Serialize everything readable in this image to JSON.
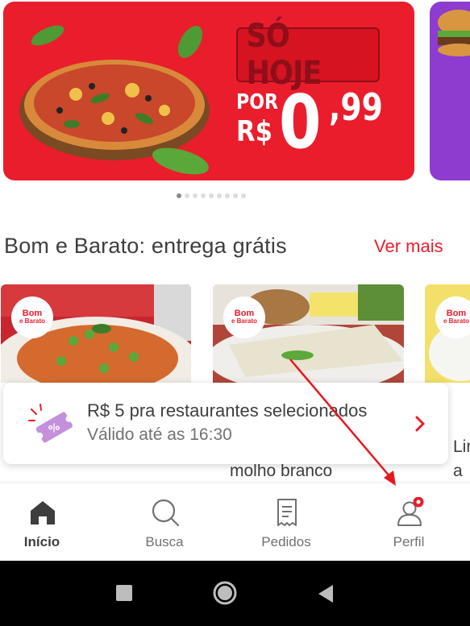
{
  "banner": {
    "title": "SÓ HOJE",
    "price_prefix_1": "POR",
    "price_prefix_2": "R$",
    "price_int": "0",
    "price_cents": ",99",
    "accent_color": "#ea1d2c",
    "next_banner_color": "#8e3bd0",
    "dots_total": 9,
    "dots_active": 1
  },
  "section": {
    "title": "Bom e Barato: entrega grátis",
    "see_more": "Ver mais"
  },
  "cards": [
    {
      "badge_line1": "Bom",
      "badge_line2": "e Barato"
    },
    {
      "badge_line1": "Bom",
      "badge_line2": "e Barato",
      "name": "molho branco"
    },
    {
      "badge_line1": "Bom",
      "badge_line2": "e Barato",
      "name_line1": "Lin",
      "name_line2": "a b"
    }
  ],
  "coupon": {
    "title": "R$ 5 pra restaurantes selecionados",
    "subtitle": "Válido até as 16:30",
    "icon": "coupon-ticket-icon"
  },
  "nav": {
    "items": [
      {
        "label": "Início",
        "icon": "home-icon",
        "active": true
      },
      {
        "label": "Busca",
        "icon": "search-icon",
        "active": false
      },
      {
        "label": "Pedidos",
        "icon": "receipt-icon",
        "active": false
      },
      {
        "label": "Perfil",
        "icon": "profile-icon",
        "active": false,
        "notification": true
      }
    ]
  },
  "system": {
    "icons": [
      "recents-square-icon",
      "home-circle-icon",
      "back-triangle-icon"
    ]
  }
}
